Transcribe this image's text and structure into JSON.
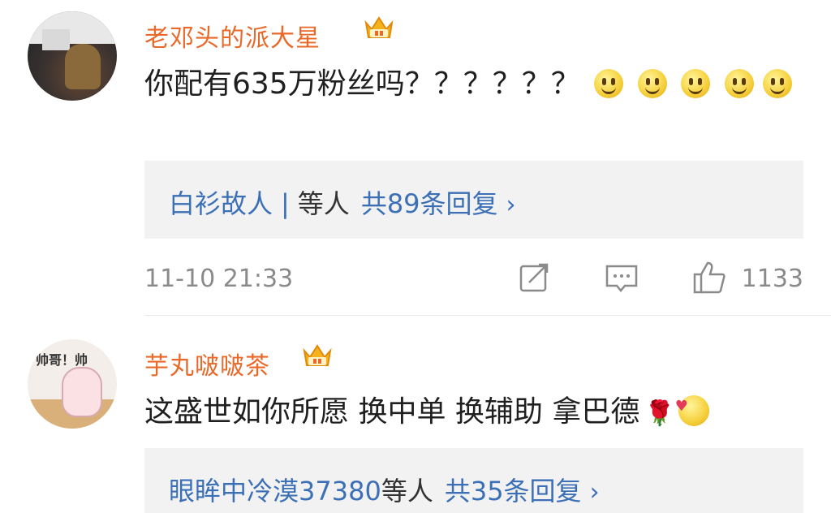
{
  "comments": [
    {
      "username": "老邓头的派大星",
      "text": "你配有635万粉丝吗？？？？？？",
      "emoji_count": 5,
      "reply_preview": {
        "names": "白衫故人",
        "separator": "|",
        "suffix": "等人",
        "count_label": "共89条回复",
        "chevron": "›"
      },
      "timestamp": "11-10 21:33",
      "like_count": "1133"
    },
    {
      "username": "芋丸啵啵茶",
      "text": "这盛世如你所愿 换中单 换辅助 拿巴德",
      "avatar_caption": "帅哥！帅",
      "reply_preview": {
        "names": "眼眸中冷漠37380",
        "suffix": "等人",
        "count_label": "共35条回复",
        "chevron": "›"
      }
    }
  ],
  "icons": {
    "crown": "crown-icon",
    "share": "share-icon",
    "comment": "comment-icon",
    "like": "thumbs-up-icon"
  },
  "colors": {
    "username": "#e8692a",
    "link": "#3b6fb6",
    "reply_bg": "#f2f2f2",
    "meta": "#8a8a8a"
  }
}
